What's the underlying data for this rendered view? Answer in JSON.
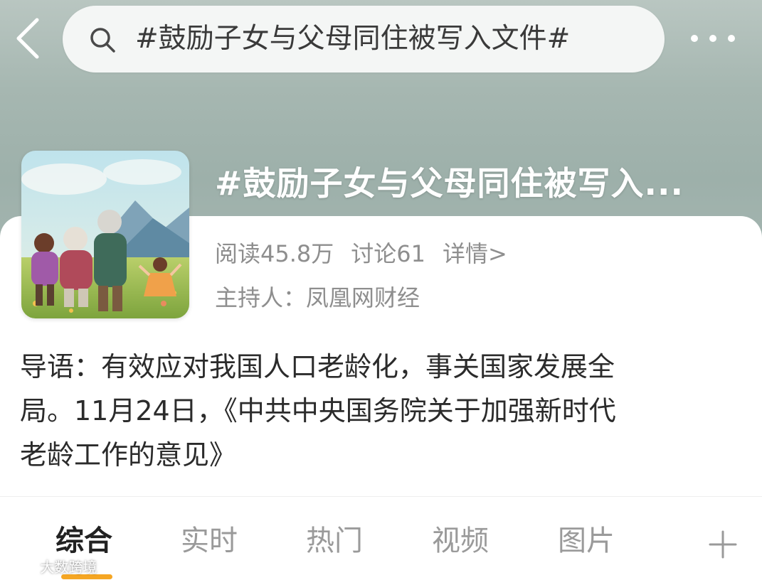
{
  "search": {
    "query": "#鼓励子女与父母同住被写入文件#"
  },
  "topic": {
    "title": "#鼓励子女与父母同住被写入...",
    "reads": "阅读45.8万",
    "discussions": "讨论61",
    "details_link": "详情>",
    "host": "主持人：凤凰网财经"
  },
  "intro": {
    "lines": [
      "导语：有效应对我国人口老龄化，事关国家发展全",
      "局。11月24日，《中共中央国务院关于加强新时代",
      "老龄工作的意见》"
    ]
  },
  "tabs": [
    {
      "label": "综合",
      "active": true
    },
    {
      "label": "实时",
      "active": false
    },
    {
      "label": "热门",
      "active": false
    },
    {
      "label": "视频",
      "active": false
    },
    {
      "label": "图片",
      "active": false
    }
  ],
  "watermark": {
    "text": "大数跨境"
  },
  "colors": {
    "header_bg": "#a6b7b1",
    "accent_underline": "#f5a623",
    "secondary_text": "#8e8e8e"
  }
}
